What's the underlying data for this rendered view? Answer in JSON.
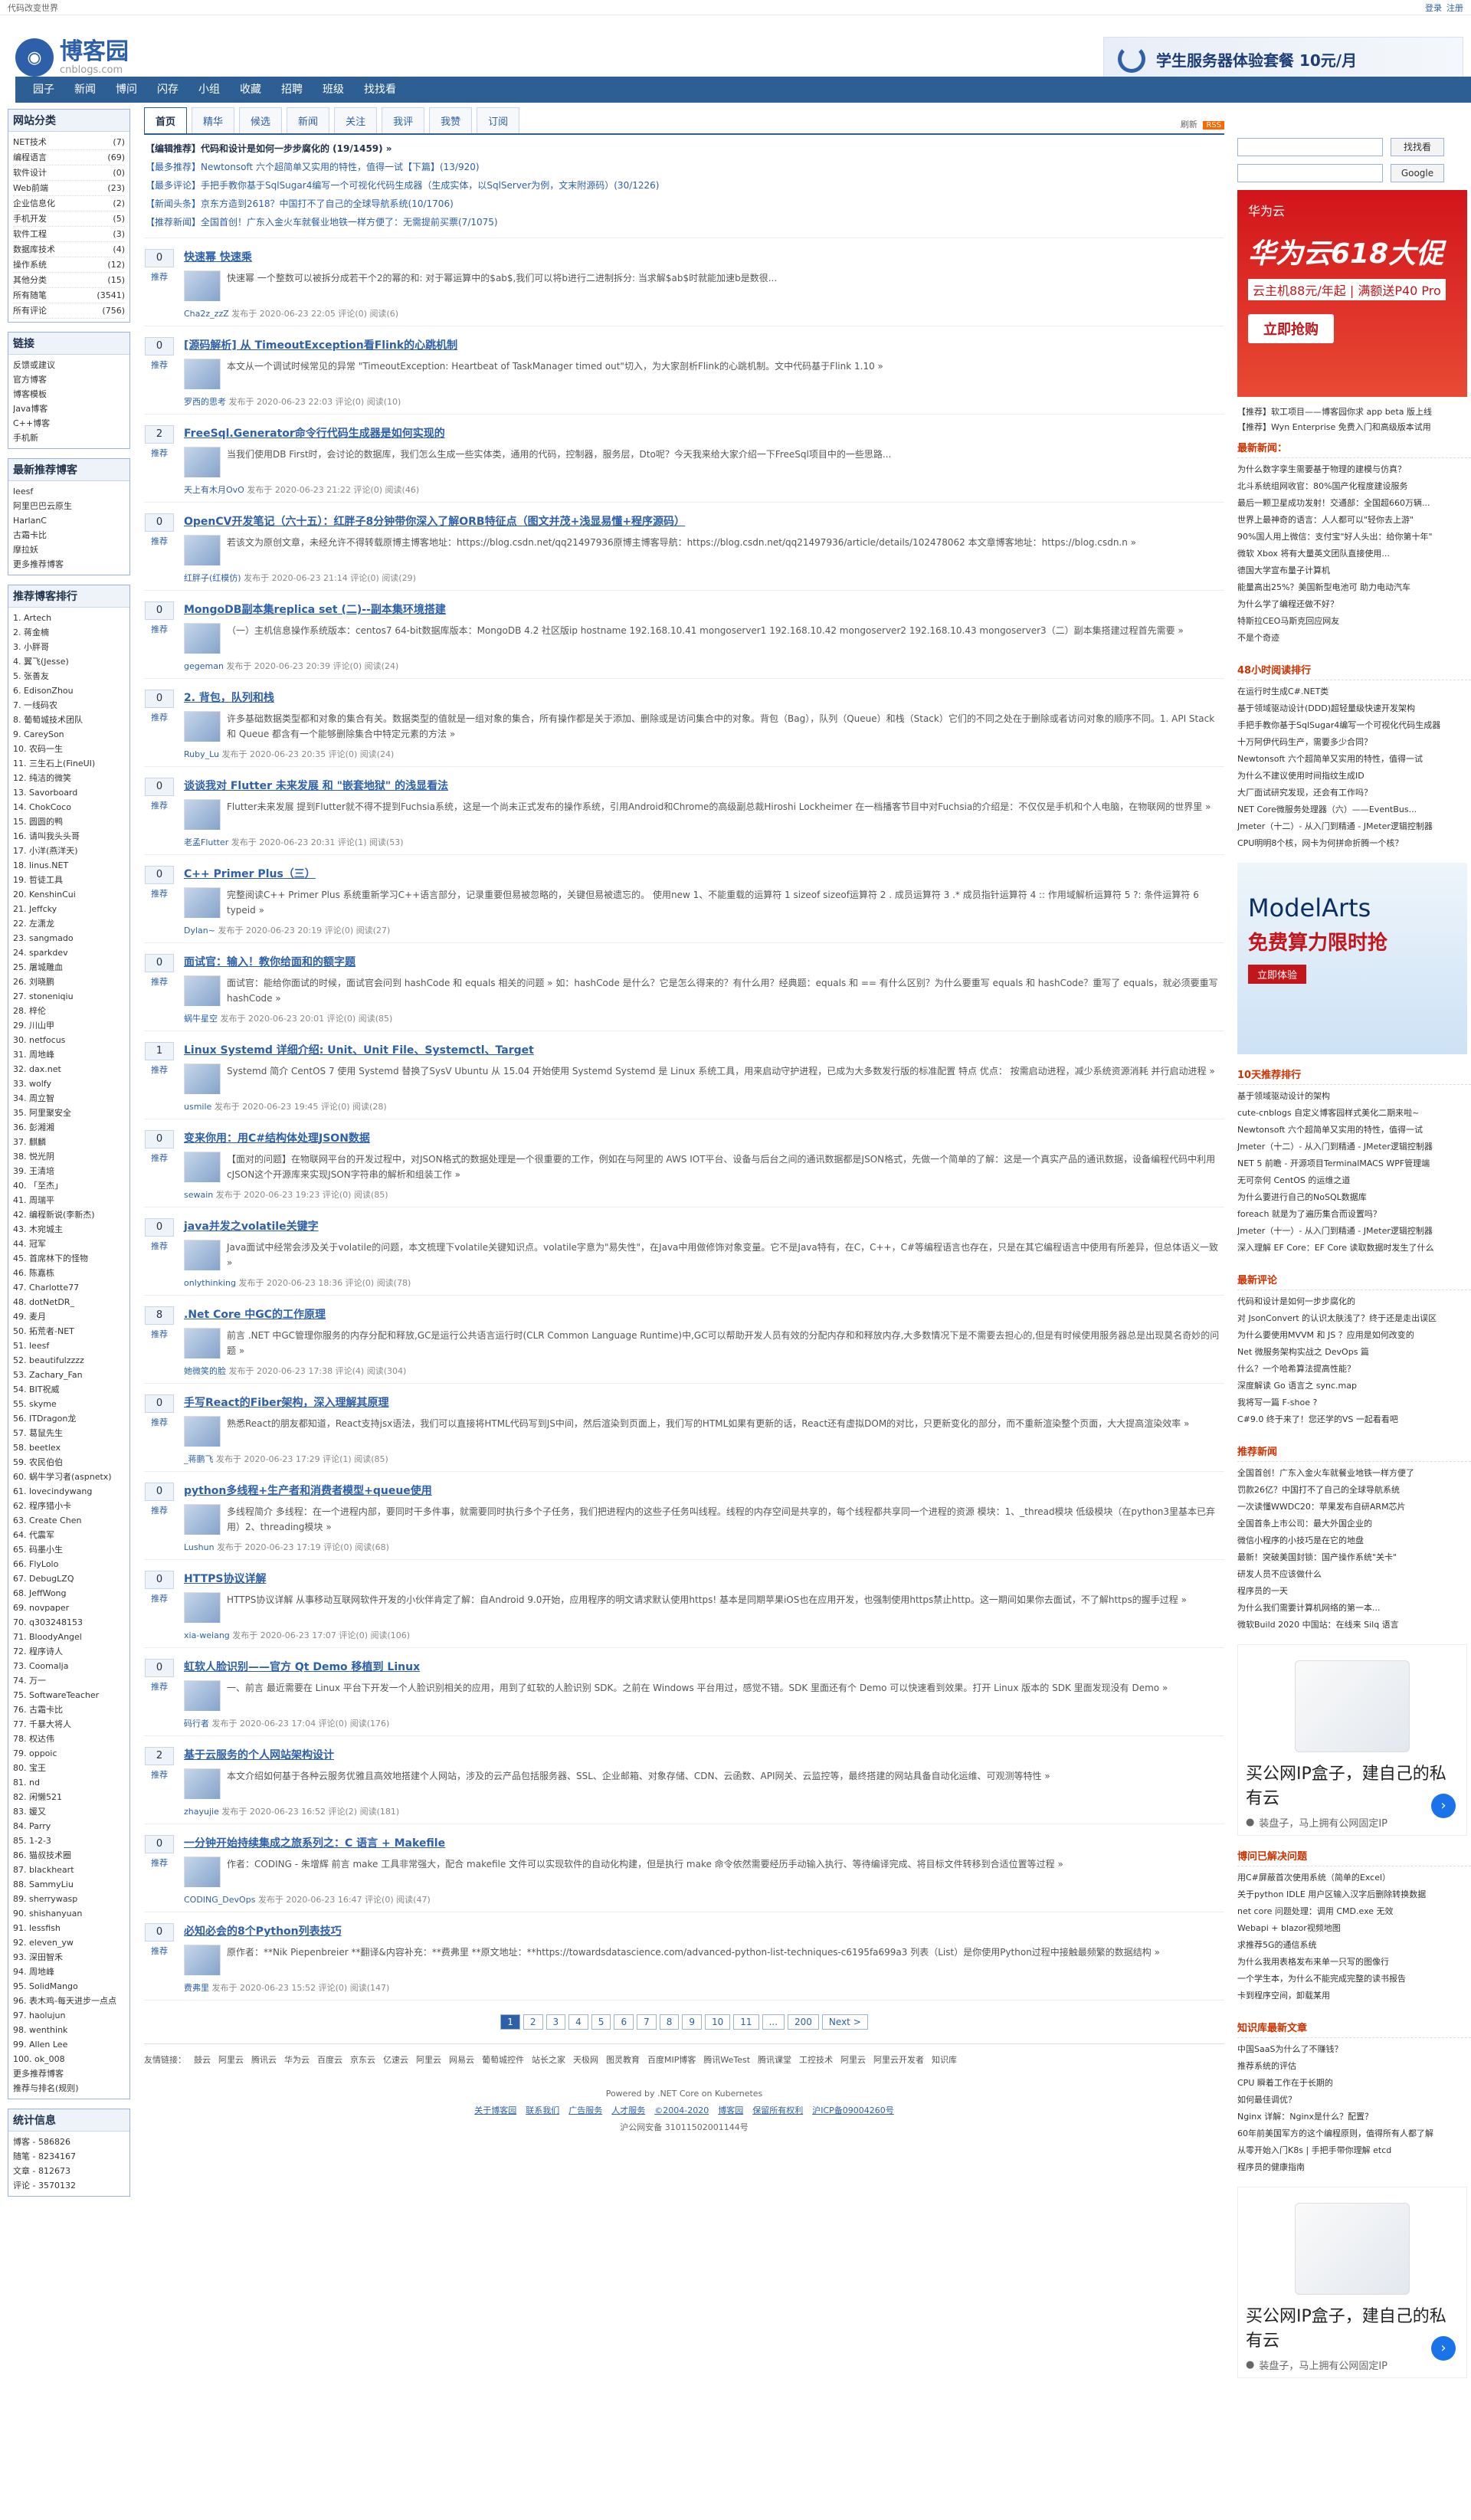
{
  "top": {
    "left": "代码改变世界",
    "links": [
      "登录",
      "注册"
    ]
  },
  "logo": {
    "cn": "博客园",
    "en": "cnblogs.com"
  },
  "header_ad": "学生服务器体验套餐 10元/月",
  "nav": [
    "园子",
    "新闻",
    "博问",
    "闪存",
    "小组",
    "收藏",
    "招聘",
    "班级",
    "找找看"
  ],
  "left": {
    "cats_title": "网站分类",
    "cats": [
      {
        "label": "NET技术",
        "count": "(7)"
      },
      {
        "label": "编程语言",
        "count": "(69)"
      },
      {
        "label": "软件设计",
        "count": "(0)"
      },
      {
        "label": "Web前端",
        "count": "(23)"
      },
      {
        "label": "企业信息化",
        "count": "(2)"
      },
      {
        "label": "手机开发",
        "count": "(5)"
      },
      {
        "label": "软件工程",
        "count": "(3)"
      },
      {
        "label": "数据库技术",
        "count": "(4)"
      },
      {
        "label": "操作系统",
        "count": "(12)"
      },
      {
        "label": "其他分类",
        "count": "(15)"
      },
      {
        "label": "所有随笔",
        "count": "(3541)"
      },
      {
        "label": "所有评论",
        "count": "(756)"
      }
    ],
    "links_title": "链接",
    "links": [
      "反馈或建议",
      "官方博客",
      "博客模板",
      "Java博客",
      "C++博客",
      "手机新"
    ],
    "rec_title": "最新推荐博客",
    "rec": [
      "leesf",
      "阿里巴巴云原生",
      "HarlanC",
      "古霜卡比",
      "摩拉妖",
      "更多推荐博客"
    ],
    "rank_title": "推荐博客排行",
    "rank": [
      "1. Artech",
      "2. 蒋金楠",
      "3. 小胖哥",
      "4. 翼飞(Jesse)",
      "5. 张善友",
      "6. EdisonZhou",
      "7. 一线码农",
      "8. 葡萄城技术团队",
      "9. CareySon",
      "10. 农码一生",
      "11. 三生石上(FineUI)",
      "12. 纯洁的微笑",
      "13. Savorboard",
      "14. ChokCoco",
      "15. 圆圆的鸭",
      "16. 请叫我头头哥",
      "17. 小洋(燕洋天)",
      "18. linus.NET",
      "19. 哲徒工具",
      "20. KenshinCui",
      "21. Jeffcky",
      "22. 左潇龙",
      "23. sangmado",
      "24. sparkdev",
      "25. 屠城雕血",
      "26. 刘晓鹏",
      "27. stoneniqiu",
      "28. 梓伦",
      "29. 川山甲",
      "30. netfocus",
      "31. 周地峰",
      "32. dax.net",
      "33. wolfy",
      "34. 周立智",
      "35. 阿里聚安全",
      "36. 彭湘湘",
      "37. 麒麟",
      "38. 悦光阴",
      "39. 王清培",
      "40. 「至杰」",
      "41. 周瑞平",
      "42. 编程新说(李新杰)",
      "43. 木宛城主",
      "44. 冠军",
      "45. 首席林下的怪物",
      "46. 陈嘉栋",
      "47. Charlotte77",
      "48. dotNetDR_",
      "49. 麦月",
      "50. 拓荒者-NET",
      "51. leesf",
      "52. beautifulzzzz",
      "53. Zachary_Fan",
      "54. BIT祝威",
      "55. skyme",
      "56. ITDragon龙",
      "57. 葛鼠先生",
      "58. beetlex",
      "59. 农民伯伯",
      "60. 蜗牛学习者(aspnetx)",
      "61. lovecindywang",
      "62. 程序猎小卡",
      "63. Create Chen",
      "64. 代震军",
      "65. 码墨小生",
      "66. FlyLolo",
      "67. DebugLZQ",
      "68. JeffWong",
      "69. novpaper",
      "70. q303248153",
      "71. BloodyAngel",
      "72. 程序诗人",
      "73. Coomalja",
      "74. 万一",
      "75. SoftwareTeacher",
      "76. 古霜卡比",
      "77. 千暴大将人",
      "78. 权达伟",
      "79. oppoic",
      "80. 宝王",
      "81. nd",
      "82. 闲懒521",
      "83. 媛又",
      "84. Parry",
      "85. 1-2-3",
      "86. 猫叔技术圈",
      "87. blackheart",
      "88. SammyLiu",
      "89. sherrywasp",
      "90. shishanyuan",
      "91. lessfish",
      "92. eleven_yw",
      "93. 深田智禾",
      "94. 周地峰",
      "95. SolidMango",
      "96. 表木鸡-每天进步一点点",
      "97. haolujun",
      "98. wenthink",
      "99. Allen Lee",
      "100. ok_008",
      "更多推荐博客",
      "推荐与排名(规则)"
    ],
    "stat_title": "统计信息",
    "stats": [
      "博客 - 586826",
      "随笔 - 8234167",
      "文章 - 812673",
      "评论 - 3570132"
    ]
  },
  "center": {
    "tabs": [
      "首页",
      "精华",
      "候选",
      "新闻",
      "关注",
      "我评",
      "我赞",
      "订阅"
    ],
    "refresh": "刷新",
    "rss": "RSS",
    "headlines": [
      "【编辑推荐】代码和设计是如何一步步腐化的 (19/1459) »",
      "【最多推荐】Newtonsoft 六个超简单又实用的特性，值得一试【下篇】(13/920)",
      "【最多评论】手把手教你基于SqlSugar4编写一个可视化代码生成器（生成实体，以SqlServer为例，文末附源码）(30/1226)",
      "【新闻头条】京东方造到2618？中国打不了自己的全球导航系统(10/1706)",
      "【推荐新闻】全国首创！广东入金火车就餐业地铁一样方便了：无需提前买票(7/1075)"
    ],
    "posts": [
      {
        "digg": "0",
        "title": "快速幂 快速乘",
        "summary": "快速幂 一个整数可以被拆分成若干个2的幂的和: 对于幂运算中的$ab$,我们可以将b进行二进制拆分: 当求解$ab$时就能加速b是数很...",
        "author": "Cha2z_zzZ",
        "time": "发布于 2020-06-23 22:05",
        "comments": "评论(0)",
        "reads": "阅读(6)"
      },
      {
        "digg": "0",
        "title": "[源码解析] 从 TimeoutException看Flink的心跳机制",
        "summary": "本文从一个调试时候常见的异常 \"TimeoutException: Heartbeat of TaskManager timed out\"切入，为大家剖析Flink的心跳机制。文中代码基于Flink 1.10 »",
        "author": "罗西的思考",
        "time": "发布于 2020-06-23 22:03",
        "comments": "评论(0)",
        "reads": "阅读(10)"
      },
      {
        "digg": "2",
        "title": "FreeSql.Generator命令行代码生成器是如何实现的",
        "summary": "当我们使用DB First时，会讨论的数据库，我们怎么生成一些实体类，通用的代码，控制器，服务层，Dto呢？今天我来给大家介绍一下FreeSql项目中的一些思路...",
        "author": "天上有木月OvO",
        "time": "发布于 2020-06-23 21:22",
        "comments": "评论(0)",
        "reads": "阅读(46)"
      },
      {
        "digg": "0",
        "title": "OpenCV开发笔记（六十五）：红胖子8分钟带你深入了解ORB特征点（图文并茂+浅显易懂+程序源码）",
        "summary": "若该文为原创文章，未经允许不得转载原博主博客地址：https://blog.csdn.net/qq21497936原博主博客导航：https://blog.csdn.net/qq21497936/article/details/102478062 本文章博客地址：https://blog.csdn.n »",
        "author": "红胖子(红模仿)",
        "time": "发布于 2020-06-23 21:14",
        "comments": "评论(0)",
        "reads": "阅读(29)"
      },
      {
        "digg": "0",
        "title": "MongoDB副本集replica set (二)--副本集环境搭建",
        "summary": "（一）主机信息操作系统版本：centos7 64-bit数据库版本：MongoDB 4.2 社区版ip hostname 192.168.10.41 mongoserver1 192.168.10.42 mongoserver2 192.168.10.43 mongoserver3（二）副本集搭建过程首先需要 »",
        "author": "gegeman",
        "time": "发布于 2020-06-23 20:39",
        "comments": "评论(0)",
        "reads": "阅读(24)"
      },
      {
        "digg": "0",
        "title": "2. 背包，队列和栈",
        "summary": "许多基础数据类型都和对象的集合有关。数据类型的值就是一组对象的集合，所有操作都是关于添加、删除或是访问集合中的对象。背包（Bag），队列（Queue）和栈（Stack）它们的不同之处在于删除或者访问对象的顺序不同。1. API Stack 和 Queue 都含有一个能够删除集合中特定元素的方法 »",
        "author": "Ruby_Lu",
        "time": "发布于 2020-06-23 20:35",
        "comments": "评论(0)",
        "reads": "阅读(24)"
      },
      {
        "digg": "0",
        "title": "谈谈我对 Flutter 未来发展 和 \"嵌套地狱\" 的浅显看法",
        "summary": "Flutter未来发展 提到Flutter就不得不提到Fuchsia系统，这是一个尚未正式发布的操作系统，引用Android和Chrome的高级副总裁Hiroshi Lockheimer 在一档播客节目中对Fuchsia的介绍是：不仅仅是手机和个人电脑，在物联网的世界里 »",
        "author": "老孟Flutter",
        "time": "发布于 2020-06-23 20:31",
        "comments": "评论(1)",
        "reads": "阅读(53)"
      },
      {
        "digg": "0",
        "title": "C++ Primer Plus（三）",
        "summary": "完整阅读C++ Primer Plus 系统重新学习C++语言部分，记录重要但易被忽略的，关键但易被遗忘的。 使用new 1、不能重载的运算符 1 sizeof sizeof运算符 2 . 成员运算符 3 .* 成员指针运算符 4 :: 作用域解析运算符 5 ?: 条件运算符 6 typeid »",
        "author": "Dylan~",
        "time": "发布于 2020-06-23 20:19",
        "comments": "评论(0)",
        "reads": "阅读(27)"
      },
      {
        "digg": "0",
        "title": "面试官：输入！教你给面和的额字题",
        "summary": "面试官：能给你面试的时候，面试官会问到 hashCode 和 equals 相关的问题 » 如：hashCode 是什么？它是怎么得来的？有什么用？经典题：equals 和 == 有什么区别？为什么要重写 equals 和 hashCode？重写了 equals，就必须要重写 hashCode »",
        "author": "蜗牛星空",
        "time": "发布于 2020-06-23 20:01",
        "comments": "评论(0)",
        "reads": "阅读(85)"
      },
      {
        "digg": "1",
        "title": "Linux Systemd 详细介绍: Unit、Unit File、Systemctl、Target",
        "summary": "Systemd 简介 CentOS 7 使用 Systemd 替换了SysV Ubuntu 从 15.04 开始使用 Systemd Systemd 是 Linux 系统工具，用来启动守护进程，已成为大多数发行版的标准配置 特点 优点： 按需启动进程，减少系统资源消耗 并行启动进程 »",
        "author": "usmile",
        "time": "发布于 2020-06-23 19:45",
        "comments": "评论(0)",
        "reads": "阅读(28)"
      },
      {
        "digg": "0",
        "title": "变来你用：用C#结构体处理JSON数据",
        "summary": "【面对的问题】在物联网平台的开发过程中，对JSON格式的数据处理是一个很重要的工作，例如在与阿里的 AWS IOT平台、设备与后台之间的通讯数据都是JSON格式，先做一个简单的了解：这是一个真实产品的通讯数据，设备编程代码中利用cJSON这个开源库来实现JSON字符串的解析和组装工作 »",
        "author": "sewain",
        "time": "发布于 2020-06-23 19:23",
        "comments": "评论(0)",
        "reads": "阅读(85)"
      },
      {
        "digg": "0",
        "title": "java并发之volatile关键字",
        "summary": "Java面试中经常会涉及关于volatile的问题，本文梳理下volatile关键知识点。volatile字意为\"易失性\"，在Java中用做修饰对象变量。它不是Java特有，在C，C++，C#等编程语言也存在，只是在其它编程语言中使用有所差异，但总体语义一致 »",
        "author": "onlythinking",
        "time": "发布于 2020-06-23 18:36",
        "comments": "评论(0)",
        "reads": "阅读(78)"
      },
      {
        "digg": "8",
        "title": ".Net Core 中GC的工作原理",
        "summary": "前言 .NET 中GC管理你服务的内存分配和释放,GC是运行公共语言运行时(CLR Common Language Runtime)中,GC可以帮助开发人员有效的分配内存和和释放内存,大多数情况下是不需要去担心的,但是有时候使用服务器总是出现莫名奇妙的问题 »",
        "author": "她微笑的脸",
        "time": "发布于 2020-06-23 17:38",
        "comments": "评论(4)",
        "reads": "阅读(304)"
      },
      {
        "digg": "0",
        "title": "手写React的Fiber架构，深入理解其原理",
        "summary": "熟悉React的朋友都知道，React支持jsx语法，我们可以直接将HTML代码写到JS中间，然后渲染到页面上，我们写的HTML如果有更新的话，React还有虚拟DOM的对比，只更新变化的部分，而不重新渲染整个页面，大大提高渲染效率 »",
        "author": "_蒋鹏飞",
        "time": "发布于 2020-06-23 17:29",
        "comments": "评论(1)",
        "reads": "阅读(85)"
      },
      {
        "digg": "0",
        "title": "python多线程+生产者和消费者模型+queue使用",
        "summary": "多线程简介 多线程：在一个进程内部，要同时干多件事，就需要同时执行多个子任务，我们把进程内的这些子任务叫线程。线程的内存空间是共享的，每个线程都共享同一个进程的资源 模块：1、_thread模块 低级模块（在python3里基本已弃用）2、threading模块 »",
        "author": "Lushun",
        "time": "发布于 2020-06-23 17:19",
        "comments": "评论(0)",
        "reads": "阅读(68)"
      },
      {
        "digg": "0",
        "title": "HTTPS协议详解",
        "summary": "HTTPS协议详解 从事移动互联网软件开发的小伙伴肯定了解：自Android 9.0开始，应用程序的明文请求默认使用https! 基本是同期苹果iOS也在应用开发，也强制使用https禁止http。这一期间如果你去面试，不了解https的握手过程 »",
        "author": "xia-weiang",
        "time": "发布于 2020-06-23 17:07",
        "comments": "评论(0)",
        "reads": "阅读(106)"
      },
      {
        "digg": "0",
        "title": "虹软人脸识别——官方 Qt Demo 移植到 Linux",
        "summary": "一、前言 最近需要在 Linux 平台下开发一个人脸识别相关的应用，用到了虹软的人脸识别 SDK。之前在 Windows 平台用过，感觉不错。SDK 里面还有个 Demo 可以快速看到效果。打开 Linux 版本的 SDK 里面发现没有 Demo »",
        "author": "码行者",
        "time": "发布于 2020-06-23 17:04",
        "comments": "评论(0)",
        "reads": "阅读(176)"
      },
      {
        "digg": "2",
        "title": "基于云服务的个人网站架构设计",
        "summary": "本文介绍如何基于各种云服务优雅且高效地搭建个人网站，涉及的云产品包括服务器、SSL、企业邮箱、对象存储、CDN、云函数、API网关、云监控等，最终搭建的网站具备自动化运维、可观测等特性 »",
        "author": "zhayujie",
        "time": "发布于 2020-06-23 16:52",
        "comments": "评论(2)",
        "reads": "阅读(181)"
      },
      {
        "digg": "0",
        "title": "一分钟开始持续集成之旅系列之：C 语言 + Makefile",
        "summary": "作者：CODING - 朱增辉 前言 make 工具非常强大，配合 makefile 文件可以实现软件的自动化构建，但是执行 make 命令依然需要经历手动输入执行、等待编译完成、将目标文件转移到合适位置等过程 »",
        "author": "CODING_DevOps",
        "time": "发布于 2020-06-23 16:47",
        "comments": "评论(0)",
        "reads": "阅读(47)"
      },
      {
        "digg": "0",
        "title": "必知必会的8个Python列表技巧",
        "summary": "原作者：**Nik Piepenbreier **翻译&内容补充：**费弗里 **原文地址：**https://towardsdatascience.com/advanced-python-list-techniques-c6195fa699a3 列表（List）是你使用Python过程中接触最频繁的数据结构 »",
        "author": "费弗里",
        "time": "发布于 2020-06-23 15:52",
        "comments": "评论(0)",
        "reads": "阅读(147)"
      }
    ],
    "pager": [
      "1",
      "2",
      "3",
      "4",
      "5",
      "6",
      "7",
      "8",
      "9",
      "10",
      "11",
      "...",
      "200",
      "Next >"
    ],
    "friends": [
      "友情链接：",
      "鼓云",
      "阿里云",
      "腾讯云",
      "华为云",
      "百度云",
      "京东云",
      "亿速云",
      "阿里云",
      "网易云",
      "葡萄城控件",
      "站长之家",
      "天极网",
      "图灵教育",
      "百度MIP博客",
      "腾讯WeTest",
      "腾讯课堂",
      "工控技术",
      "阿里云",
      "阿里云开发者",
      "知识库"
    ],
    "footer": {
      "powered": "Powered by .NET Core on Kubernetes",
      "links": [
        "关于博客园",
        "联系我们",
        "广告服务",
        "人才服务",
        "©2004-2020",
        "博客园",
        "保留所有权利",
        "沪ICP备09004260号"
      ],
      "beian": "沪公网安备 31011502001144号"
    }
  },
  "right": {
    "search_btns": [
      "找找看",
      "Google"
    ],
    "huawei_ad": {
      "brand": "华为云",
      "title": "华为云618大促",
      "sub": "云主机88元/年起 | 满额送P40 Pro",
      "cta": "立即抢购"
    },
    "promo": [
      "【推荐】软工项目——博客园你求 app beta 版上线",
      "【推荐】Wyn Enterprise 免费入门和高级版本试用"
    ],
    "news_title": "最新新闻：",
    "news": [
      "为什么数字孪生需要基于物理的建模与仿真？",
      "北斗系统组网收官：80%国产化程度建设服务",
      "最后一颗卫星成功发射！交通部：全国超660万辆...",
      "世界上最神奇的语言：人人都可以\"轻你去上游\"",
      "90%国人用上微信：支付宝\"好人头出：给你第十年\"",
      "微软 Xbox 将有大量英文团队直接使用...",
      "德国大学宣布量子计算机",
      "能量高出25%？美国新型电池可 助力电动汽车",
      "为什么学了编程还做不好？",
      "特斯拉CEO马斯克回应网友",
      "不是个奇迹"
    ],
    "hot_title": "48小时阅读排行",
    "hot": [
      "在运行时生成C#.NET类",
      "基于领域驱动设计(DDD)超轻量级快速开发架构",
      "手把手教你基于SqlSugar4编写一个可视化代码生成器",
      "十万阿伊代码生产，需要多少合同？",
      "Newtonsoft 六个超简单又实用的特性，值得一试",
      "为什么不建议使用时间指纹生成ID",
      "大厂面试研究发现，还会有工作吗？",
      "NET Core微服务处理器（六）——EventBus...",
      "Jmeter（十二）- 从入门到精通 - JMeter逻辑控制器",
      "CPU明明8个核，网卡为何拼命折腾一个核？"
    ],
    "ma_ad": {
      "t": "ModelArts",
      "s": "免费算力限时抢",
      "c": "立即体验"
    },
    "top10_title": "10天推荐排行",
    "top10": [
      "基于领域驱动设计的架构",
      "cute-cnblogs 自定义博客园样式美化二期来啦~",
      "Newtonsoft 六个超简单又实用的特性，值得一试",
      "Jmeter（十二）- 从入门到精通 - JMeter逻辑控制器",
      "NET 5 前瞻 - 开源项目TerminalMACS WPF管理端",
      "无可奈何 CentOS 的运维之道",
      "为什么要进行自己的NoSQL数据库",
      "foreach 就是为了遍历集合而设置吗？",
      "Jmeter（十一）- 从入门到精通 - JMeter逻辑控制器",
      "深入理解 EF Core：EF Core 读取数据时发生了什么"
    ],
    "news2_title": "最新评论",
    "news2": [
      "代码和设计是如何一步步腐化的",
      "对 JsonConvert 的认识太肤浅了？终于还是走出误区",
      "为什么要使用MVVM 和 JS ？应用是如何改变的",
      "Net 微服务架构实战之 DevOps 篇",
      "什么？一个哈希算法提高性能？",
      "深度解读 Go 语言之 sync.map",
      "我将写一篇 F-shoe ?",
      "C#9.0 终于来了！您还学的VS 一起看看吧"
    ],
    "rec_news_title": "推荐新闻",
    "rec_news": [
      "全国首创！广东入金火车就餐业地铁一样方便了",
      "罚款26亿？中国打不了自己的全球导航系统",
      "一次读懂WWDC20：苹果发布自研ARM芯片",
      "全国首条上市公司：最大外国企业的",
      "微信小程序的小技巧是在它的地盘",
      "最新！突破美国封锁：国产操作系统\"关卡\"",
      "研发人员不应该做什么",
      "程序员的一天",
      "为什么我们需要计算机网络的第一本...",
      "微软Build 2020 中国站：在线来 Silq 语言"
    ],
    "jd_ad": {
      "t": "买公网IP盒子，建自己的私有云",
      "s": "装盘子，马上拥有公网固定IP"
    },
    "recent_title": "博问已解决问题",
    "recent": [
      "用C#屏蔽首次使用系统（简单的Excel）",
      "关于python IDLE 用户区输入汉字后删除转换数据",
      "net core 问题处理：调用 CMD.exe 无效",
      "Webapi + blazor视频地图",
      "求推荐5G的通信系统",
      "为什么我用表格发布来单一只写的图像行",
      "一个学生本，为什么不能完成完整的读书报告",
      "卡到程序空间，卸载某用"
    ],
    "know_title": "知识库最新文章",
    "know": [
      "中国SaaS为什么了不赚钱？",
      "推荐系统的评估",
      "CPU 瞬着工作在于长期的",
      "如何最佳调优？",
      "Nginx 详解：Nginx是什么？配置？",
      "60年前美国军方的这个编程原则，值得所有人都了解",
      "从零开始入门K8s | 手把手带你理解 etcd",
      "程序员的健康指南"
    ]
  }
}
